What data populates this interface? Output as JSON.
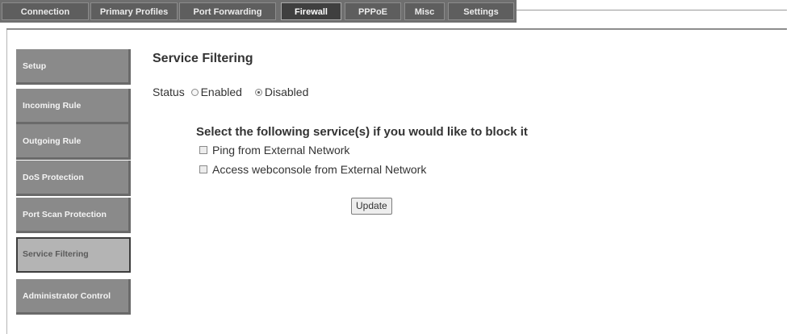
{
  "tabs": [
    {
      "label": "Connection",
      "active": false
    },
    {
      "label": "Primary Profiles",
      "active": false
    },
    {
      "label": "Port Forwarding",
      "active": false
    },
    {
      "label": "Firewall",
      "active": true
    },
    {
      "label": "PPPoE",
      "active": false
    },
    {
      "label": "Misc",
      "active": false
    },
    {
      "label": "Settings",
      "active": false
    }
  ],
  "sidebar": {
    "items": [
      {
        "label": "Setup",
        "active": false
      },
      {
        "label": "Incoming Rule",
        "active": false
      },
      {
        "label": "Outgoing Rule",
        "active": false
      },
      {
        "label": "DoS Protection",
        "active": false
      },
      {
        "label": "Port Scan Protection",
        "active": false
      },
      {
        "label": "Service Filtering",
        "active": true
      },
      {
        "label": "Administrator Control",
        "active": false
      }
    ]
  },
  "main": {
    "title": "Service Filtering",
    "status": {
      "label": "Status",
      "options": [
        {
          "label": "Enabled",
          "selected": false
        },
        {
          "label": "Disabled",
          "selected": true
        }
      ]
    },
    "instruction": "Select the following service(s) if you would like to block it",
    "services": [
      {
        "label": "Ping from External Network",
        "checked": false
      },
      {
        "label": "Access webconsole from External Network",
        "checked": false
      }
    ],
    "update_label": "Update"
  }
}
